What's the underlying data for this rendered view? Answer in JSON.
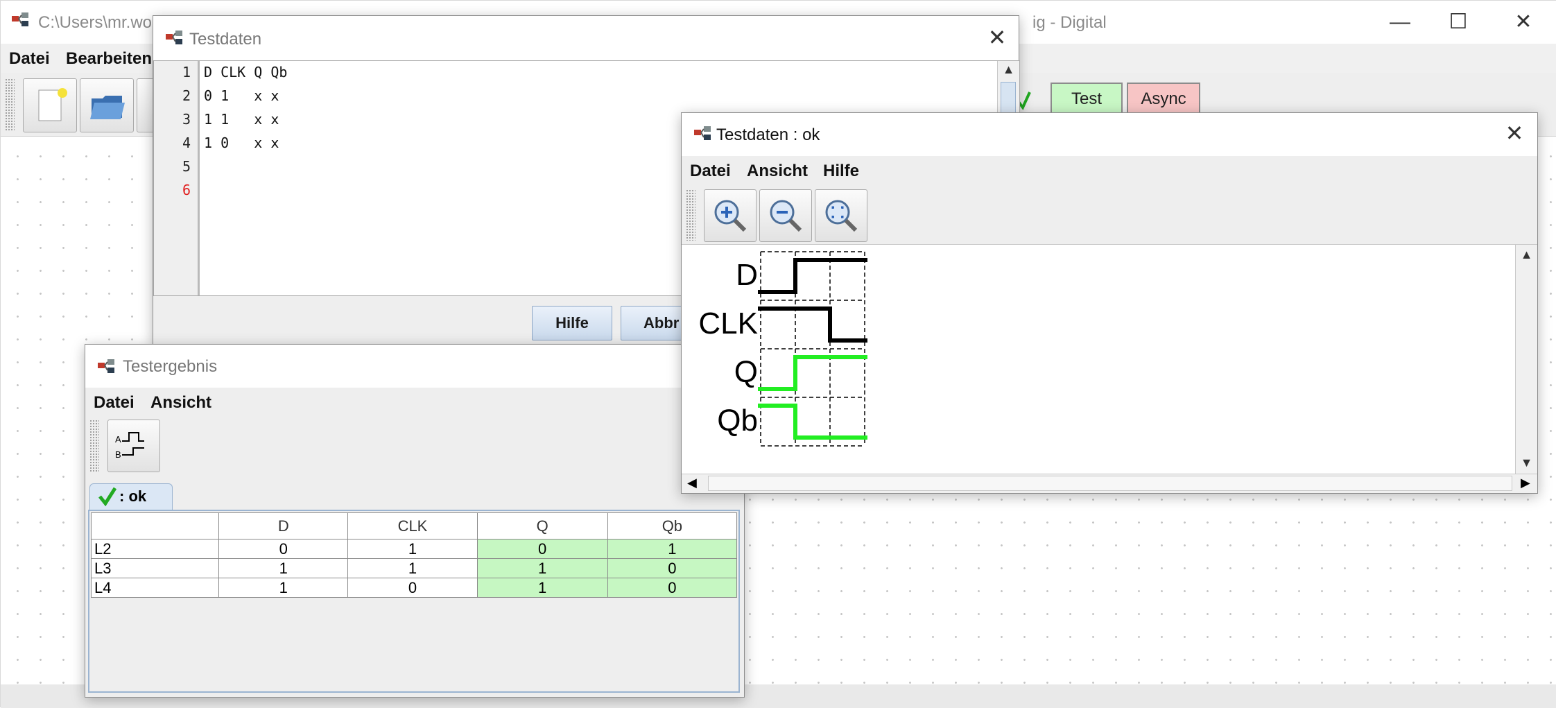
{
  "main": {
    "title": "C:\\Users\\mr.woc",
    "title_suffix": "ig - Digital",
    "menu": [
      "Datei",
      "Bearbeiten"
    ],
    "mode_buttons": [
      {
        "label": "Test",
        "color": "#c8f7c5"
      },
      {
        "label": "Async",
        "color": "#f7c5c5"
      }
    ],
    "window_controls": {
      "minimize": "—",
      "maximize": "☐",
      "close": "✕"
    }
  },
  "testdaten_editor": {
    "title": "Testdaten",
    "lines": [
      {
        "num": "1",
        "text": "D CLK Q Qb"
      },
      {
        "num": "2",
        "text": "0 1   x x"
      },
      {
        "num": "3",
        "text": "1 1   x x"
      },
      {
        "num": "4",
        "text": "1 0   x x"
      },
      {
        "num": "5",
        "text": ""
      },
      {
        "num": "6",
        "text": ""
      }
    ],
    "buttons": {
      "help": "Hilfe",
      "cancel": "Abbr"
    }
  },
  "testergebnis": {
    "title": "Testergebnis",
    "menu": [
      "Datei",
      "Ansicht"
    ],
    "tab_label": ": ok",
    "columns": [
      "",
      "D",
      "CLK",
      "Q",
      "Qb"
    ],
    "rows": [
      {
        "label": "L2",
        "D": "0",
        "CLK": "1",
        "Q": "0",
        "Qb": "1"
      },
      {
        "label": "L3",
        "D": "1",
        "CLK": "1",
        "Q": "1",
        "Qb": "0"
      },
      {
        "label": "L4",
        "D": "1",
        "CLK": "0",
        "Q": "1",
        "Qb": "0"
      }
    ],
    "ok_color": "#c6f7c2"
  },
  "timing_window": {
    "title": "Testdaten : ok",
    "menu": [
      "Datei",
      "Ansicht",
      "Hilfe"
    ],
    "toolbar": [
      "zoom-in-icon",
      "zoom-out-icon",
      "zoom-fit-icon"
    ],
    "signals": [
      {
        "name": "D",
        "values": [
          0,
          1,
          1
        ],
        "color": "#000000"
      },
      {
        "name": "CLK",
        "values": [
          1,
          1,
          0
        ],
        "color": "#000000"
      },
      {
        "name": "Q",
        "values": [
          0,
          1,
          1
        ],
        "color": "#22ee22"
      },
      {
        "name": "Qb",
        "values": [
          1,
          0,
          0
        ],
        "color": "#22ee22"
      }
    ]
  }
}
